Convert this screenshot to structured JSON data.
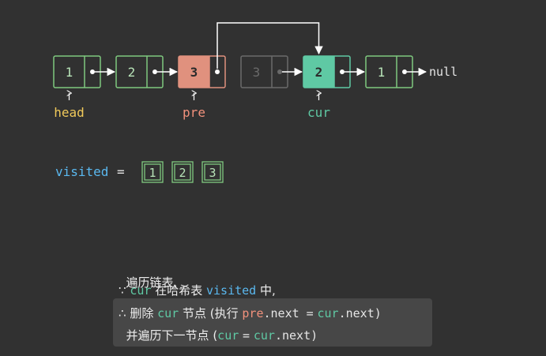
{
  "colors": {
    "background": "#313131",
    "node_border": "#7fc97f",
    "node_text": "#b8e4b8",
    "pre_fill": "#e0917e",
    "cur_fill": "#5fc9a4",
    "faded": "#6a6a6a",
    "arrow": "#ffffff",
    "head_label": "#f0c95a",
    "pre_label": "#f2917c",
    "cur_label": "#5fc9a4",
    "visited_label": "#5ab8ef"
  },
  "list": {
    "nodes": [
      {
        "value": "1",
        "state": "normal"
      },
      {
        "value": "2",
        "state": "normal"
      },
      {
        "value": "3",
        "state": "pre"
      },
      {
        "value": "3",
        "state": "removed"
      },
      {
        "value": "2",
        "state": "cur"
      },
      {
        "value": "1",
        "state": "normal"
      }
    ],
    "terminal": "null",
    "pointers": [
      {
        "label": "head",
        "node": 0,
        "color_key": "head_label"
      },
      {
        "label": "pre",
        "node": 2,
        "color_key": "pre_label"
      },
      {
        "label": "cur",
        "node": 4,
        "color_key": "cur_label"
      }
    ],
    "bypass_from": 2,
    "bypass_to": 4
  },
  "visited": {
    "label": "visited",
    "equals": "=",
    "items": [
      "1",
      "2",
      "3"
    ]
  },
  "explanation": {
    "line1": "遍历链表,",
    "line2": {
      "because": "∵",
      "cur": "cur",
      "mid": "在哈希表",
      "visited": "visited",
      "end": "中,"
    },
    "line3": {
      "therefore": "∴",
      "a": "删除",
      "cur": "cur",
      "b": "节点 (执行",
      "pre": "pre",
      "c": ".next =",
      "cur2": "cur",
      "d": ".next)"
    },
    "line4": {
      "a": "并遍历下一节点 (",
      "cur": "cur",
      "b": "=",
      "cur2": "cur",
      "c": ".next)"
    }
  }
}
